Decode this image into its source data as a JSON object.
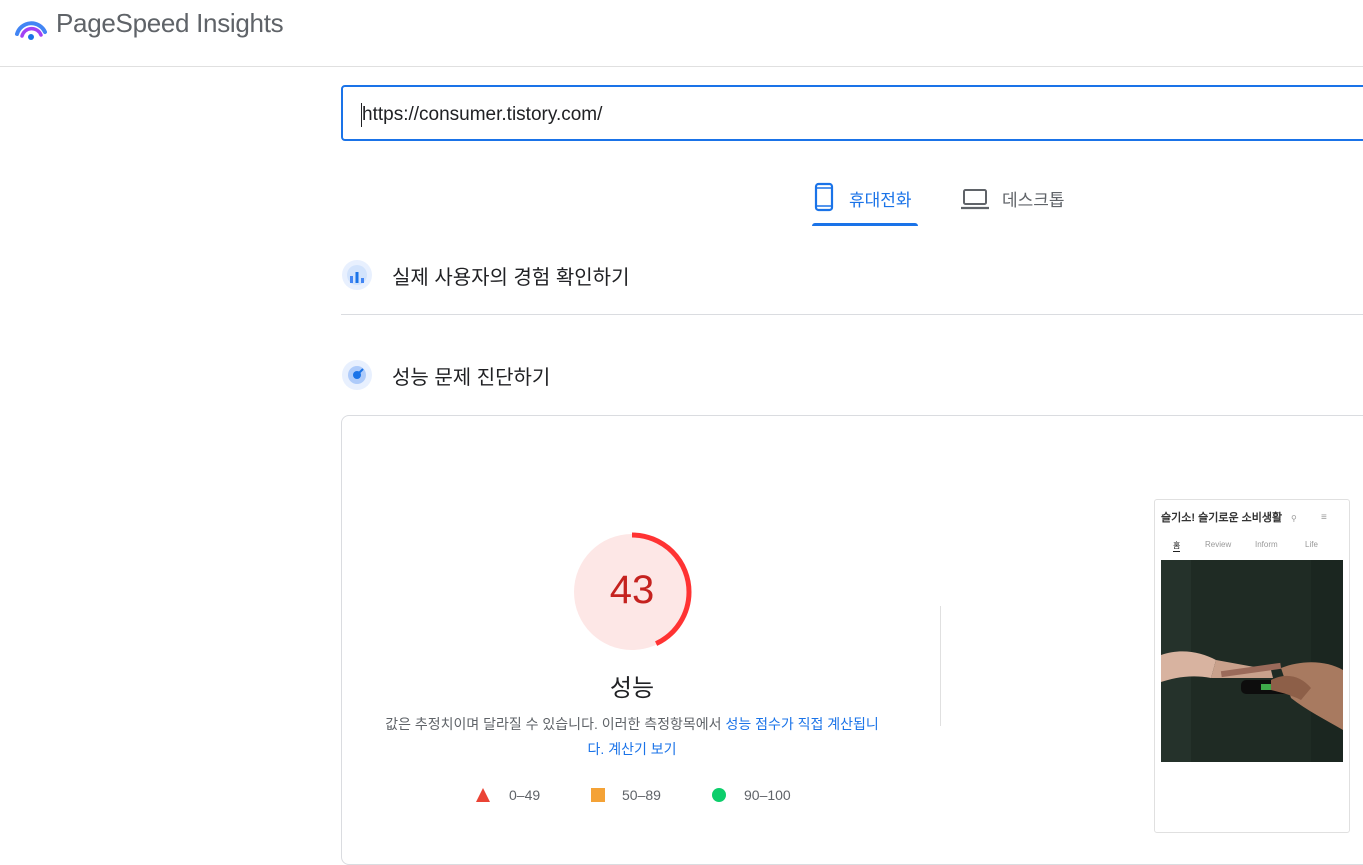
{
  "app": {
    "title": "PageSpeed Insights"
  },
  "url_input": {
    "value": "https://consumer.tistory.com/"
  },
  "device_tabs": [
    {
      "label": "휴대전화",
      "selected": true
    },
    {
      "label": "데스크톱",
      "selected": false
    }
  ],
  "sections": {
    "field_data": {
      "title": "실제 사용자의 경험 확인하기"
    },
    "diagnose": {
      "title": "성능 문제 진단하기"
    }
  },
  "performance": {
    "score": "43",
    "score_value": 43,
    "label": "성능",
    "description_prefix": "값은 추정치이며 달라질 수 있습니다. 이러한 측정항목에서 ",
    "description_link": "성능 점수가 직접 계산됩니다.",
    "calculator_link": "계산기 보기"
  },
  "legend": [
    {
      "label": "0–49",
      "color": "#ea4335",
      "shape": "triangle"
    },
    {
      "label": "50–89",
      "color": "#f4a236",
      "shape": "square"
    },
    {
      "label": "90–100",
      "color": "#0cce6b",
      "shape": "circle"
    }
  ],
  "screenshot": {
    "site_title": "슬기소! 슬기로운 소비생활",
    "nav": [
      "홈",
      "Review",
      "Inform",
      "Life"
    ]
  },
  "colors": {
    "accent": "#1a73e8",
    "fail": "#c5221f",
    "fail_ring": "#ff3333",
    "fail_bg": "#fde7e6"
  }
}
